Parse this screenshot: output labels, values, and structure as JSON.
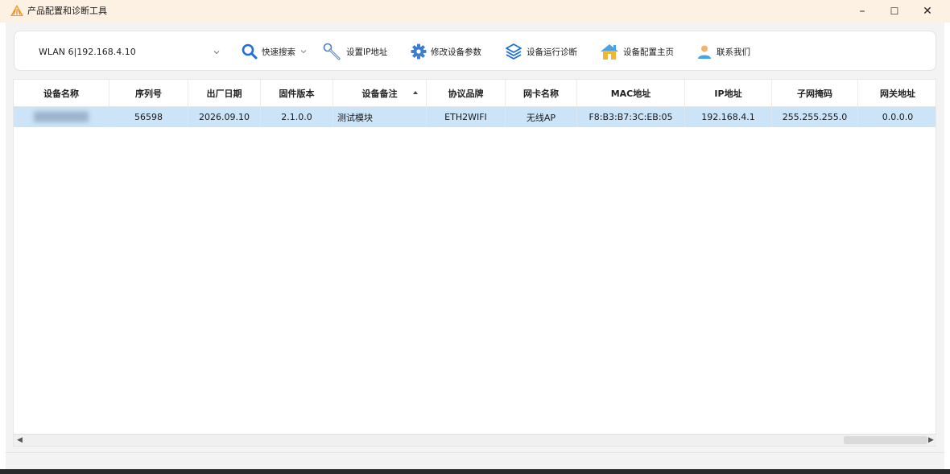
{
  "window": {
    "title": "产品配置和诊断工具",
    "logo_icon": "warning-stripes-logo",
    "minimize": "–",
    "maximize": "☐",
    "close": "✕"
  },
  "toolbar": {
    "adapter": {
      "selected": "WLAN 6|192.168.4.10",
      "icon": "chevron-down-icon"
    },
    "quick_search": {
      "label": "快速搜索",
      "icon": "search-icon"
    },
    "set_ip": {
      "label": "设置IP地址",
      "icon": "wrench-icon"
    },
    "modify_params": {
      "label": "修改设备参数",
      "icon": "gear-icon"
    },
    "run_diag": {
      "label": "设备运行诊断",
      "icon": "layers-icon"
    },
    "config_home": {
      "label": "设备配置主页",
      "icon": "home-icon"
    },
    "contact": {
      "label": "联系我们",
      "icon": "person-icon"
    }
  },
  "table": {
    "columns": [
      "设备名称",
      "序列号",
      "出厂日期",
      "固件版本",
      "设备备注",
      "协议品牌",
      "网卡名称",
      "MAC地址",
      "IP地址",
      "子网掩码",
      "网关地址"
    ],
    "sorted_column": "设备备注",
    "sort_direction": "ascending",
    "rows": [
      {
        "name": "████████",
        "serial": "56598",
        "date": "2026.09.10",
        "firmware": "2.1.0.0",
        "remark": "测试模块",
        "protocol": "ETH2WIFI",
        "nic": "无线AP",
        "mac": "F8:B3:B7:3C:EB:05",
        "ip": "192.168.4.1",
        "mask": "255.255.255.0",
        "gateway": "0.0.0.0"
      }
    ],
    "selected_row_color": "#cce4f7"
  },
  "scrollbar": {
    "left_arrow": "◀",
    "right_arrow": "▶"
  },
  "colors": {
    "titlebar_bg": "#fdf1e4",
    "accent_blue": "#1e6fd9",
    "logo_orange": "#e8891c"
  }
}
